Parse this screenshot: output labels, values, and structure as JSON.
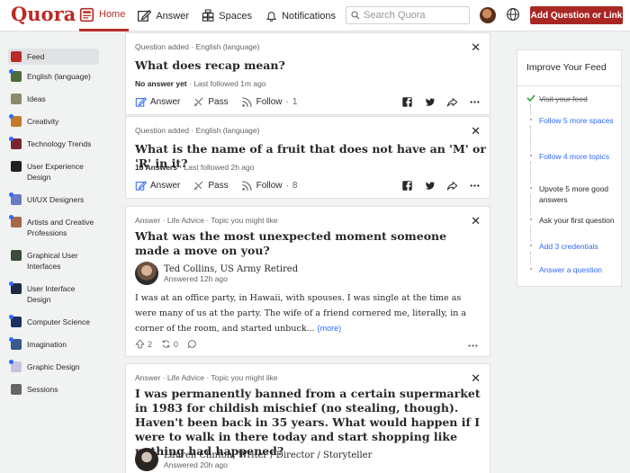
{
  "header": {
    "logo": "Quora",
    "nav": [
      {
        "label": "Home",
        "icon": "home-icon",
        "active": true
      },
      {
        "label": "Answer",
        "icon": "edit-icon"
      },
      {
        "label": "Spaces",
        "icon": "spaces-icon"
      },
      {
        "label": "Notifications",
        "icon": "bell-icon"
      }
    ],
    "search_placeholder": "Search Quora",
    "add_button": "Add Question or Link"
  },
  "sidebar": {
    "items": [
      {
        "label": "Feed",
        "color": "#b92b27",
        "active": true,
        "dot": false
      },
      {
        "label": "English (language)",
        "color": "#4b6b3b",
        "dot": true
      },
      {
        "label": "Ideas",
        "color": "#8a8a6a",
        "dot": false
      },
      {
        "label": "Creativity",
        "color": "#c47a2c",
        "dot": true
      },
      {
        "label": "Technology Trends",
        "color": "#7a2630",
        "dot": true
      },
      {
        "label": "User Experience Design",
        "color": "#222222",
        "dot": false
      },
      {
        "label": "UI/UX Designers",
        "color": "#6a7cc4",
        "dot": true
      },
      {
        "label": "Artists and Creative Professions",
        "color": "#a8674a",
        "dot": true
      },
      {
        "label": "Graphical User Interfaces",
        "color": "#3a4c3a",
        "dot": false
      },
      {
        "label": "User Interface Design",
        "color": "#1d2a44",
        "dot": true
      },
      {
        "label": "Computer Science",
        "color": "#1c2f63",
        "dot": true
      },
      {
        "label": "Imagination",
        "color": "#385a8a",
        "dot": true
      },
      {
        "label": "Graphic Design",
        "color": "#c8c4e0",
        "dot": true
      },
      {
        "label": "Sessions",
        "color": "#666666",
        "dot": false
      }
    ]
  },
  "feed": [
    {
      "meta": "Question added · English (language)",
      "title": "What does recap mean?",
      "stat_bold": "No answer yet",
      "stat_rest": " · Last followed 1m ago",
      "answer_label": "Answer",
      "pass_label": "Pass",
      "follow_label": "Follow",
      "follow_count": "1"
    },
    {
      "meta": "Question added · English (language)",
      "title": "What is the name of a fruit that does not have an 'M' or 'R' in it?",
      "stat_bold": "18 Answers",
      "stat_rest": " · Last followed 2h ago",
      "answer_label": "Answer",
      "pass_label": "Pass",
      "follow_label": "Follow",
      "follow_count": "8"
    },
    {
      "meta": "Answer · Life Advice · Topic you might like",
      "title": "What was the most unexpected moment someone made a move on you?",
      "author": "Ted Collins, US Army Retired",
      "time": "Answered 12h ago",
      "text": "I was at an office party, in Hawaii, with spouses. I was single at the time as were many of us at the party. The wife of a friend cornered me, literally, in a corner of the room, and started unbuck...",
      "more": "(more)",
      "upvotes": "2",
      "shares": "0"
    },
    {
      "meta": "Answer · Life Advice · Topic you might like",
      "title": "I was permanently banned from a certain supermarket in 1983 for childish mischief (no stealing, though). Haven't been back in 35 years. What would happen if I were to walk in there today and start shopping like nothing had happened?",
      "author": "Lauren Clinton, Writer / Director / Storyteller",
      "time": "Answered 20h ago"
    }
  ],
  "improve": {
    "title": "Improve Your Feed",
    "items": [
      {
        "label": "Visit your feed",
        "state": "done"
      },
      {
        "label": "Follow 5 more spaces",
        "state": "link"
      },
      {
        "label": "Follow 4 more topics",
        "state": "link"
      },
      {
        "label": "Upvote 5 more good answers",
        "state": "plain"
      },
      {
        "label": "Ask your first question",
        "state": "plain"
      },
      {
        "label": "Add 3 credentials",
        "state": "link"
      },
      {
        "label": "Answer a question",
        "state": "link"
      }
    ]
  },
  "colors": {
    "brand": "#b92b27",
    "link": "#2e69ff"
  }
}
